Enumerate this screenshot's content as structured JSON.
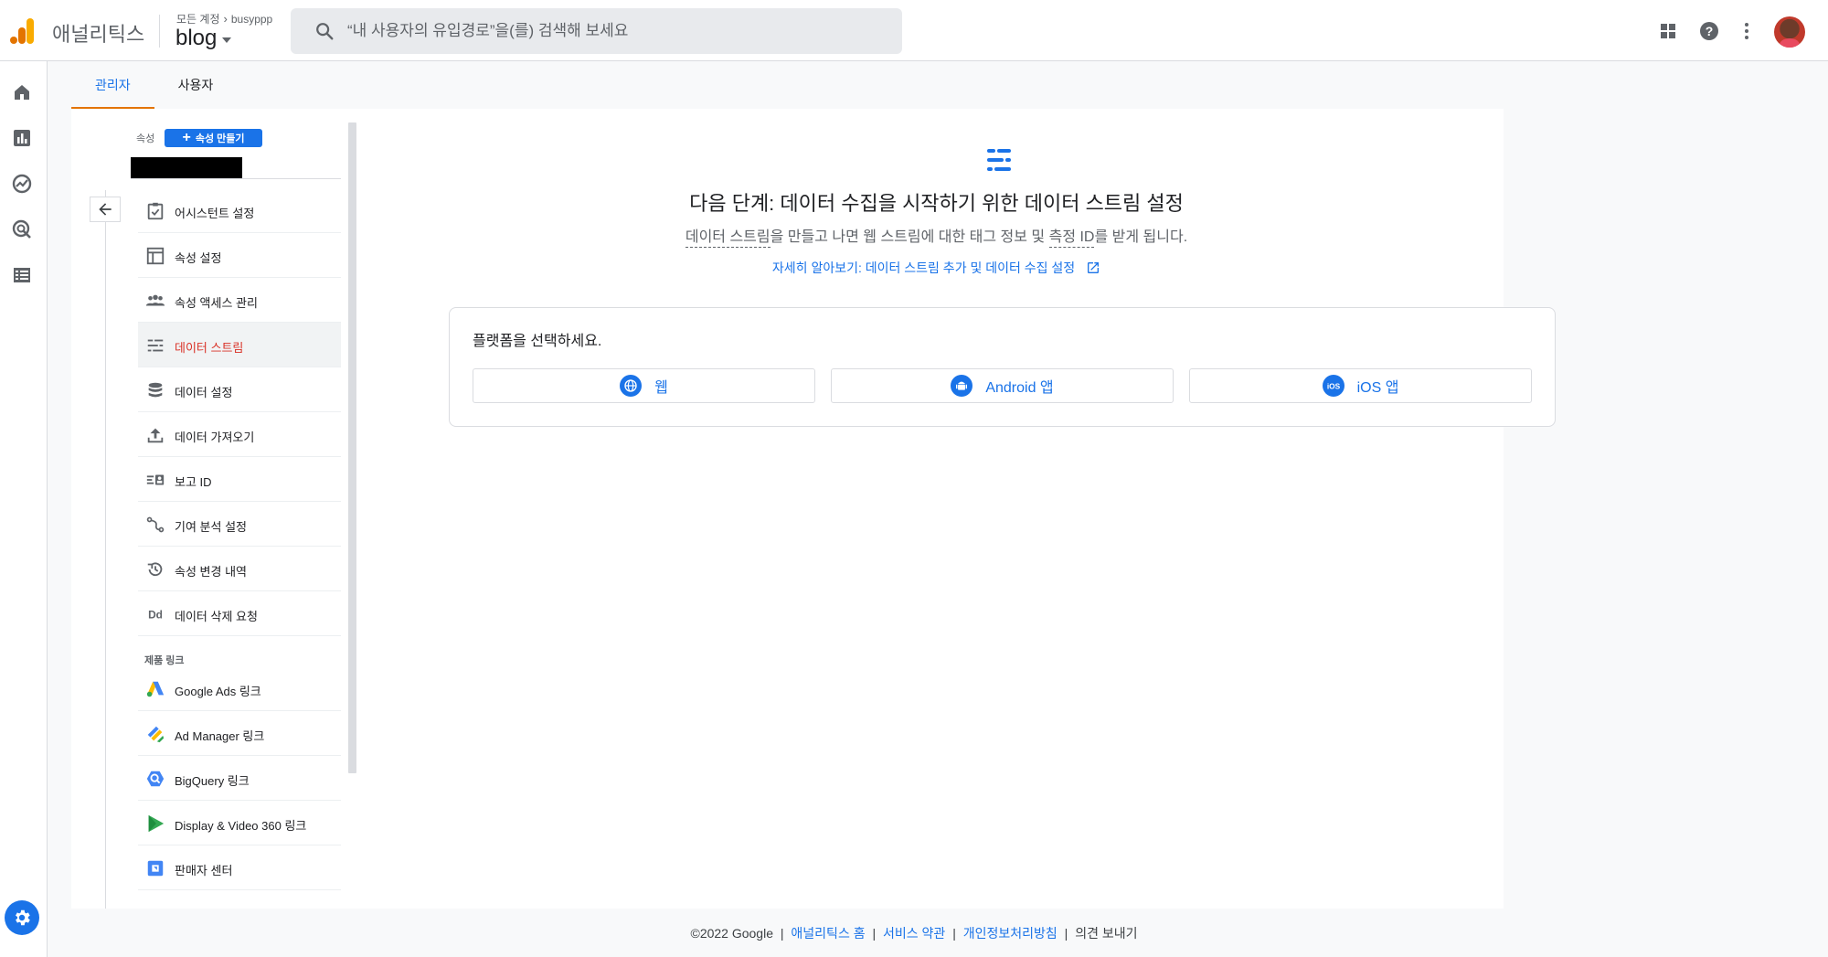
{
  "app": {
    "name": "애널리틱스",
    "account_label": "모든 계정",
    "account_name": "busyppp",
    "property_name": "blog"
  },
  "search": {
    "placeholder": "“내 사용자의 유입경로”을(를) 검색해 보세요"
  },
  "tabs": [
    {
      "label": "관리자",
      "active": true
    },
    {
      "label": "사용자",
      "active": false
    }
  ],
  "sidebar": {
    "property_label": "속성",
    "create_button": "속성 만들기",
    "items": [
      {
        "label": "어시스턴트 설정",
        "icon": "checklist-icon"
      },
      {
        "label": "속성 설정",
        "icon": "layout-icon"
      },
      {
        "label": "속성 액세스 관리",
        "icon": "people-icon"
      },
      {
        "label": "데이터 스트림",
        "icon": "stream-icon",
        "active": true
      },
      {
        "label": "데이터 설정",
        "icon": "database-icon"
      },
      {
        "label": "데이터 가져오기",
        "icon": "upload-icon"
      },
      {
        "label": "보고 ID",
        "icon": "id-icon"
      },
      {
        "label": "기여 분석 설정",
        "icon": "attribution-icon"
      },
      {
        "label": "속성 변경 내역",
        "icon": "history-icon"
      },
      {
        "label": "데이터 삭제 요청",
        "icon": "dd-icon"
      }
    ],
    "section_label": "제품 링크",
    "links": [
      {
        "label": "Google Ads 링크",
        "icon": "google-ads-icon"
      },
      {
        "label": "Ad Manager 링크",
        "icon": "ad-manager-icon"
      },
      {
        "label": "BigQuery 링크",
        "icon": "bigquery-icon"
      },
      {
        "label": "Display & Video 360 링크",
        "icon": "dv360-icon"
      },
      {
        "label": "판매자 센터",
        "icon": "merchant-center-icon"
      }
    ]
  },
  "content": {
    "title": "다음 단계: 데이터 수집을 시작하기 위한 데이터 스트림 설정",
    "subtitle_a": "데이터 스트림",
    "subtitle_b": "을 만들고 나면 웹 스트림에 대한 태그 정보 및 ",
    "subtitle_c": "측정 ID",
    "subtitle_d": "를 받게 됩니다.",
    "learn_more": "자세히 알아보기: 데이터 스트림 추가 및 데이터 수집 설정",
    "platform_prompt": "플랫폼을 선택하세요.",
    "platforms": [
      {
        "label": "웹",
        "icon": "globe-icon"
      },
      {
        "label": "Android 앱",
        "icon": "android-icon"
      },
      {
        "label": "iOS 앱",
        "icon": "ios-icon"
      }
    ]
  },
  "footer": {
    "copyright": "©2022 Google",
    "links": [
      "애널리틱스 홈",
      "서비스 약관",
      "개인정보처리방침"
    ],
    "feedback": "의견 보내기"
  },
  "colors": {
    "accent": "#1a73e8",
    "active_item": "#d93025",
    "tab_underline": "#e37400"
  }
}
